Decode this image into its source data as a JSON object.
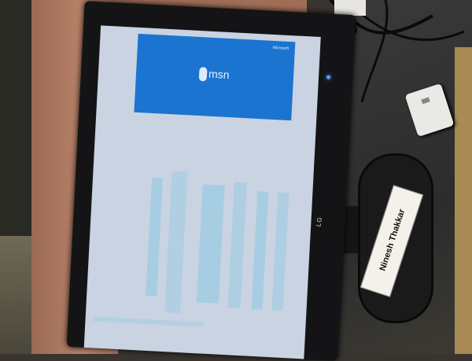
{
  "screen": {
    "tile_brand": "msn",
    "tile_corner_label": "Microsoft",
    "monitor_logo": "LG"
  },
  "nameplate": {
    "text": "Ninesh Thakkar"
  },
  "icons": [
    "msn-butterfly-icon",
    "power-led-icon"
  ],
  "colors": {
    "msn_blue": "#1b74d0",
    "screen_bg": "#c9d3e2",
    "column_bg": "#a7cde2"
  }
}
